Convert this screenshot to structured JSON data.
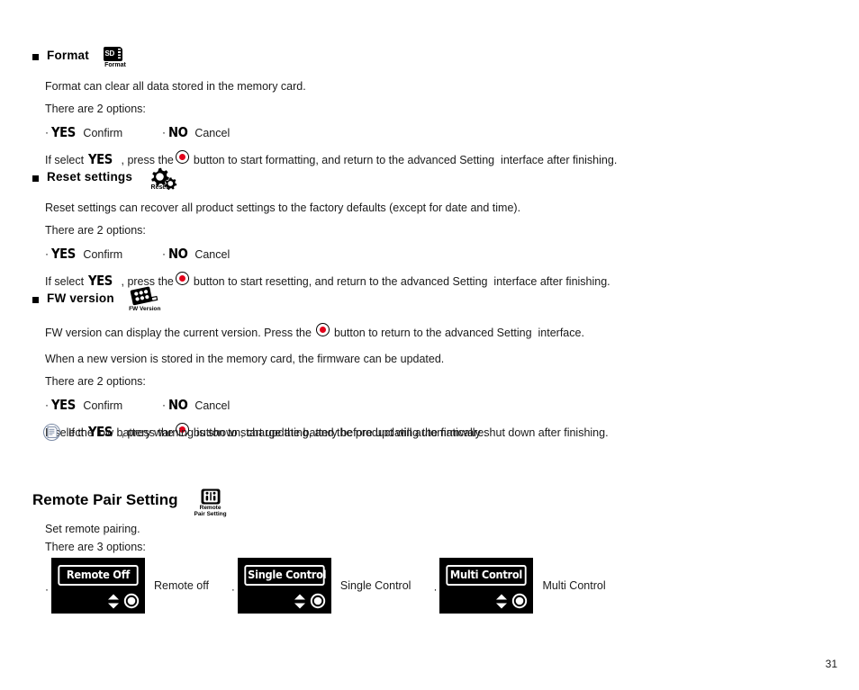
{
  "document": {
    "page_number": "31"
  },
  "sections": [
    {
      "id": "format",
      "title": "Format",
      "icon_caption": "Format",
      "icon_label": "SD",
      "desc": "Format can clear all data stored in the memory card.",
      "options_intro": "There are 2 options:",
      "options": [
        {
          "word": "YES",
          "label": "Confirm"
        },
        {
          "word": "NO",
          "label": "Cancel"
        }
      ],
      "action_pre": "If select",
      "action_word": "YES",
      "action_mid": ", press the",
      "action_post": "button to start formatting, and return to the advanced Setting  interface after finishing."
    },
    {
      "id": "reset-settings",
      "title": "Reset settings",
      "icon_caption": "Reset",
      "desc": "Reset settings can recover all product settings to the factory defaults (except for date and time).",
      "options_intro": "There are 2 options:",
      "options": [
        {
          "word": "YES",
          "label": "Confirm"
        },
        {
          "word": "NO",
          "label": "Cancel"
        }
      ],
      "action_pre": "If select",
      "action_word": "YES",
      "action_mid": ", press the",
      "action_post": "button to start resetting, and return to the advanced Setting  interface after finishing."
    },
    {
      "id": "fw-version",
      "title": "FW version",
      "icon_caption": "FW Version",
      "desc_pre": "FW version can display the current version. Press the",
      "desc_post": "button to return to the advanced Setting  interface.",
      "desc2": "When a new version is stored in the memory card, the firmware can be updated.",
      "options_intro": "There are 2 options:",
      "options": [
        {
          "word": "YES",
          "label": "Confirm"
        },
        {
          "word": "NO",
          "label": "Cancel"
        }
      ],
      "action_pre": "If select",
      "action_word": "YES",
      "action_mid": ", press the",
      "action_post": "button to start updating, and the product will automatically shut down after finishing."
    }
  ],
  "note": {
    "text": "If the low battery warning is shown, charge the battery before updating the firmware.",
    "icon_color": "#7b8ba6"
  },
  "remote_pair": {
    "title": "Remote Pair Setting",
    "icon_caption": "Remote\nPair Setting",
    "desc": "Set remote pairing.",
    "options_intro": "There are 3 options:",
    "options": [
      {
        "screen_label": "Remote Off",
        "caption": "Remote off"
      },
      {
        "screen_label": "Single Control",
        "caption": "Single Control"
      },
      {
        "screen_label": "Multi Control",
        "caption": "Multi Control"
      }
    ]
  },
  "colors": {
    "record_red": "#e2001a",
    "lcd_background": "#000000",
    "lcd_text": "#ffffff"
  }
}
